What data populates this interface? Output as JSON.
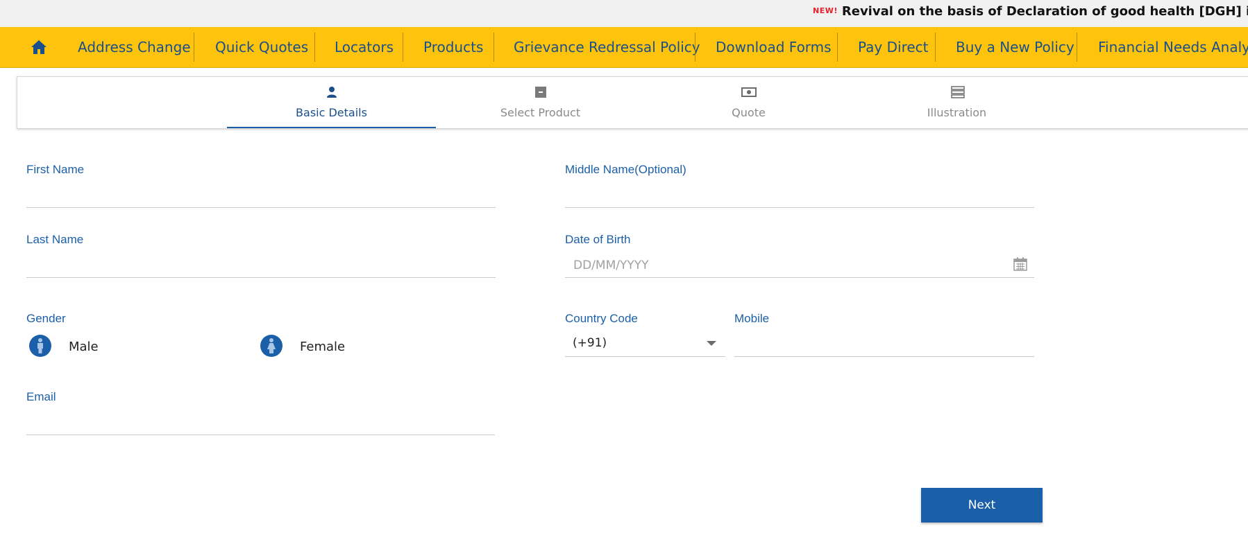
{
  "ticker": {
    "badge": "NEW!",
    "text": "Revival on the basis of Declaration of good health [DGH] is available"
  },
  "nav": {
    "home_icon": "home-icon",
    "items": [
      {
        "label": "Address Change"
      },
      {
        "label": "Quick Quotes"
      },
      {
        "label": "Locators"
      },
      {
        "label": "Products"
      },
      {
        "label": "Grievance Redressal Policy"
      },
      {
        "label": "Download Forms"
      },
      {
        "label": "Pay Direct"
      },
      {
        "label": "Buy a New Policy"
      },
      {
        "label": "Financial Needs Analysis"
      }
    ]
  },
  "steps": [
    {
      "label": "Basic Details",
      "icon": "user-icon",
      "active": true
    },
    {
      "label": "Select Product",
      "icon": "box-icon",
      "active": false
    },
    {
      "label": "Quote",
      "icon": "money-icon",
      "active": false
    },
    {
      "label": "Illustration",
      "icon": "list-icon",
      "active": false
    }
  ],
  "form": {
    "first_name": {
      "label": "First Name",
      "value": ""
    },
    "middle_name": {
      "label": "Middle Name(Optional)",
      "value": ""
    },
    "last_name": {
      "label": "Last Name",
      "value": ""
    },
    "dob": {
      "label": "Date of Birth",
      "placeholder": "DD/MM/YYYY",
      "icon": "calendar-icon"
    },
    "gender": {
      "label": "Gender",
      "options": [
        {
          "label": "Male",
          "icon": "male-icon"
        },
        {
          "label": "Female",
          "icon": "female-icon"
        }
      ]
    },
    "country_code": {
      "label": "Country Code",
      "value": "(+91)"
    },
    "mobile": {
      "label": "Mobile",
      "value": ""
    },
    "email": {
      "label": "Email",
      "value": ""
    }
  },
  "actions": {
    "next_label": "Next"
  },
  "colors": {
    "nav_bg": "#fdc30d",
    "primary": "#1b5fa8",
    "new_badge": "#e8202a"
  }
}
